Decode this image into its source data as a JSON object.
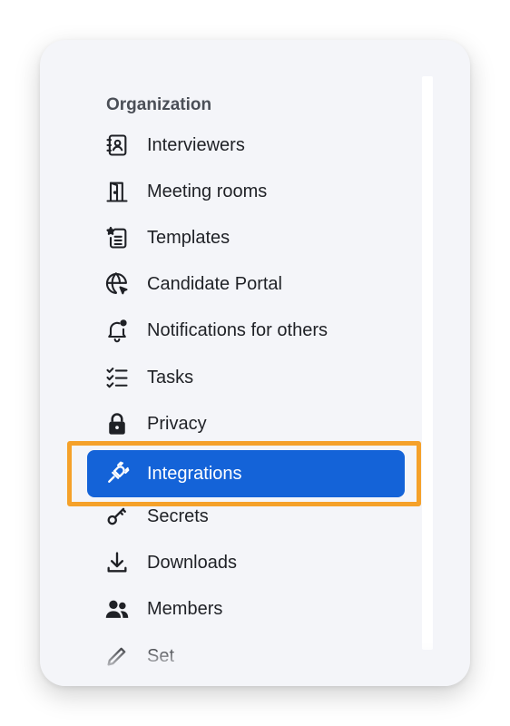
{
  "section": {
    "title": "Organization"
  },
  "menu": {
    "items": [
      {
        "label": "Interviewers",
        "icon": "contact-book-icon"
      },
      {
        "label": "Meeting rooms",
        "icon": "door-icon"
      },
      {
        "label": "Templates",
        "icon": "template-icon"
      },
      {
        "label": "Candidate Portal",
        "icon": "globe-cursor-icon"
      },
      {
        "label": "Notifications for others",
        "icon": "bell-icon"
      },
      {
        "label": "Tasks",
        "icon": "checklist-icon"
      },
      {
        "label": "Privacy",
        "icon": "lock-icon"
      },
      {
        "label": "Integrations",
        "icon": "plug-icon",
        "active": true
      },
      {
        "label": "Secrets",
        "icon": "key-icon"
      },
      {
        "label": "Downloads",
        "icon": "download-icon"
      },
      {
        "label": "Members",
        "icon": "members-icon"
      },
      {
        "label": "Set",
        "icon": "pen-icon"
      }
    ]
  },
  "colors": {
    "accent": "#1463d8",
    "highlight_outline": "#f5a12a",
    "panel_bg": "#f4f5f9",
    "text": "#1f2126"
  }
}
